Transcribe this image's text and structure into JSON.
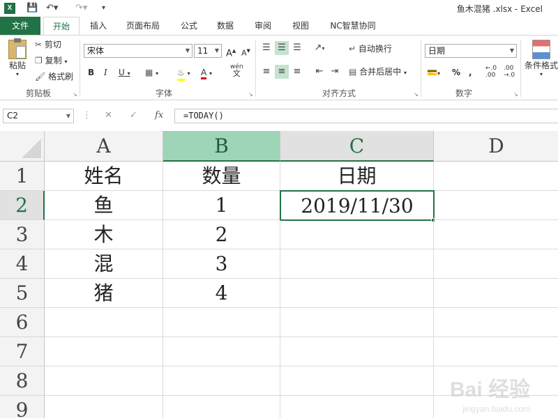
{
  "window": {
    "title": "鱼木混猪 .xlsx - Excel",
    "app_icon": "X"
  },
  "quick_access": {
    "save_icon": "save-icon",
    "undo_icon": "undo-icon",
    "redo_icon": "redo-icon",
    "customize_icon": "customize-icon"
  },
  "tabs": [
    "文件",
    "开始",
    "插入",
    "页面布局",
    "公式",
    "数据",
    "审阅",
    "视图",
    "NC智慧协同"
  ],
  "active_tab": "开始",
  "ribbon": {
    "clipboard": {
      "paste": "粘贴",
      "cut": "剪切",
      "copy": "复制",
      "format_painter": "格式刷",
      "label": "剪贴板"
    },
    "font": {
      "name": "宋体",
      "size": "11",
      "bold": "B",
      "italic": "I",
      "underline": "U",
      "wen": "wén",
      "wen2": "文",
      "label": "字体"
    },
    "alignment": {
      "wrap": "自动换行",
      "merge": "合并后居中",
      "label": "对齐方式"
    },
    "number": {
      "format": "日期",
      "percent": "%",
      "comma": ",",
      "inc": ".0",
      "dec": ".00",
      "label": "数字"
    },
    "styles": {
      "conditional": "条件格式"
    }
  },
  "formula_bar": {
    "name_box": "C2",
    "formula": "=TODAY()",
    "fx": "fx"
  },
  "columns": [
    "A",
    "B",
    "C",
    "D"
  ],
  "rows": [
    "1",
    "2",
    "3",
    "4",
    "5",
    "6",
    "7",
    "8",
    "9"
  ],
  "cells": {
    "A1": "姓名",
    "B1": "数量",
    "C1": "日期",
    "A2": "鱼",
    "B2": "1",
    "C2": "2019/11/30",
    "A3": "木",
    "B3": "2",
    "A4": "混",
    "B4": "3",
    "A5": "猪",
    "B5": "4"
  },
  "watermark": {
    "main": "Bai 经验",
    "sub": "jingyan.baidu.com"
  },
  "colors": {
    "accent": "#217346",
    "selected_header": "#9fd5b7"
  }
}
